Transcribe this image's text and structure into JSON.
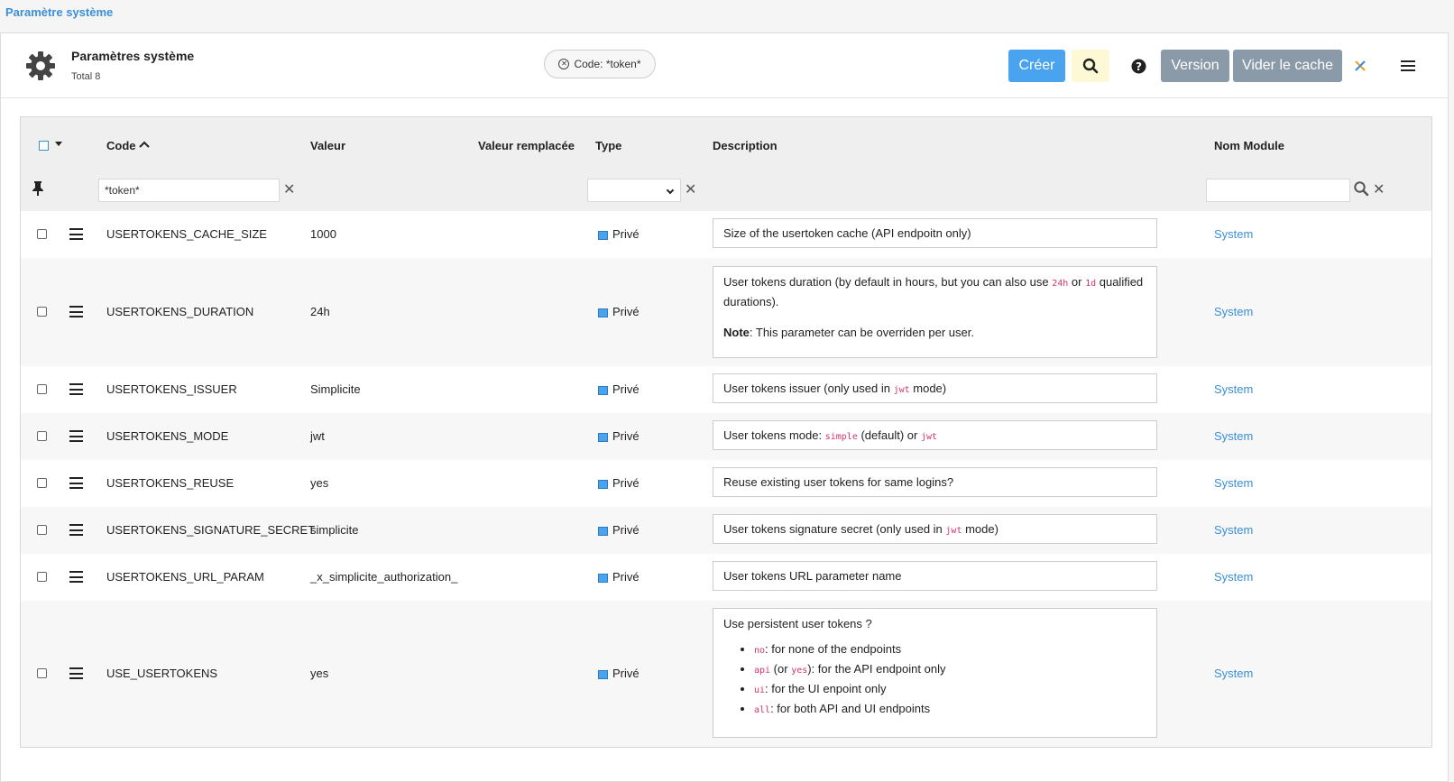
{
  "breadcrumb": "Paramètre système",
  "header": {
    "title": "Paramètres système",
    "total": "Total 8",
    "filter_pill": "Code: *token*",
    "buttons": {
      "create": "Créer",
      "version": "Version",
      "clear_cache": "Vider le cache"
    },
    "icons": [
      "gear-icon",
      "search-icon",
      "help-icon",
      "close-icon",
      "menu-icon"
    ]
  },
  "columns": {
    "code": "Code",
    "value": "Valeur",
    "overridden": "Valeur remplacée",
    "type": "Type",
    "description": "Description",
    "module": "Nom Module"
  },
  "filters": {
    "code": "*token*",
    "type": "",
    "module": ""
  },
  "colors": {
    "accent": "#4aa3ef",
    "link": "#3a8fd9",
    "grey_button": "#8a9aa8",
    "code": "#d6336c"
  },
  "rows": [
    {
      "code": "USERTOKENS_CACHE_SIZE",
      "value": "1000",
      "type": "Privé",
      "module": "System",
      "description": {
        "text": "Size of the usertoken cache (API endpoitn only)"
      }
    },
    {
      "code": "USERTOKENS_DURATION",
      "value": "24h",
      "type": "Privé",
      "module": "System",
      "description": {
        "line1a": "User tokens duration (by default in hours, but you can also use ",
        "code1": "24h",
        "line1b": " or ",
        "code2": "1d",
        "line1c": " qualified durations).",
        "note_label": "Note",
        "note_text": ": This parameter can be overriden per user."
      }
    },
    {
      "code": "USERTOKENS_ISSUER",
      "value": "Simplicite",
      "type": "Privé",
      "module": "System",
      "description": {
        "a": "User tokens issuer (only used in ",
        "code": "jwt",
        "b": " mode)"
      }
    },
    {
      "code": "USERTOKENS_MODE",
      "value": "jwt",
      "type": "Privé",
      "module": "System",
      "description": {
        "a": "User tokens mode: ",
        "code1": "simple",
        "b": " (default) or ",
        "code2": "jwt"
      }
    },
    {
      "code": "USERTOKENS_REUSE",
      "value": "yes",
      "type": "Privé",
      "module": "System",
      "description": {
        "text": "Reuse existing user tokens for same logins?"
      }
    },
    {
      "code": "USERTOKENS_SIGNATURE_SECRET",
      "value": "simplicite",
      "type": "Privé",
      "module": "System",
      "description": {
        "a": "User tokens signature secret (only used in ",
        "code": "jwt",
        "b": " mode)"
      }
    },
    {
      "code": "USERTOKENS_URL_PARAM",
      "value": "_x_simplicite_authorization_",
      "type": "Privé",
      "module": "System",
      "description": {
        "text": "User tokens URL parameter name"
      }
    },
    {
      "code": "USE_USERTOKENS",
      "value": "yes",
      "type": "Privé",
      "module": "System",
      "description": {
        "intro": "Use persistent user tokens ?",
        "items": [
          {
            "code": "no",
            "text": ": for none of the endpoints"
          },
          {
            "code": "api",
            "mid1": " (or ",
            "code2": "yes",
            "text": "): for the API endpoint only"
          },
          {
            "code": "ui",
            "text": ": for the UI enpoint only"
          },
          {
            "code": "all",
            "text": ": for both API and UI endpoints"
          }
        ]
      }
    }
  ]
}
